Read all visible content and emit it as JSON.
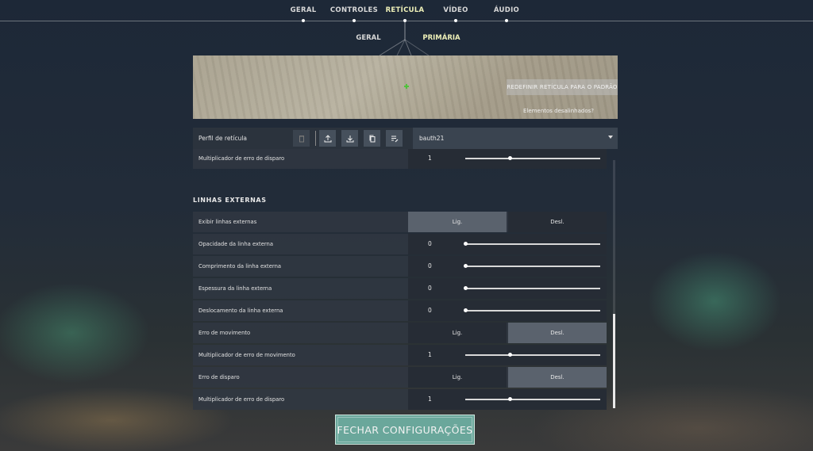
{
  "nav": {
    "tabs": [
      {
        "label": "GERAL",
        "active": false
      },
      {
        "label": "CONTROLES",
        "active": false
      },
      {
        "label": "RETÍCULA",
        "active": true
      },
      {
        "label": "VÍDEO",
        "active": false
      },
      {
        "label": "ÁUDIO",
        "active": false
      }
    ],
    "subtabs": [
      {
        "label": "GERAL",
        "active": false
      },
      {
        "label": "PRIMÁRIA",
        "active": true
      }
    ]
  },
  "preview": {
    "reset_label": "REDEFINIR RETÍCULA PARA O PADRÃO",
    "misaligned_label": "Elementos desalinhados?",
    "crosshair_color": "#4fc33b"
  },
  "profile": {
    "label": "Perfil de retícula",
    "selected": "bauth21",
    "buttons": [
      "trash-icon",
      "upload-icon",
      "download-icon",
      "copy-icon",
      "rename-icon"
    ]
  },
  "settings": {
    "top_row": {
      "label": "Multiplicador de erro de disparo",
      "value": "1",
      "fraction": 0.33
    },
    "section_title": "LINHAS EXTERNAS",
    "rows": [
      {
        "type": "toggle",
        "label": "Exibir linhas externas",
        "on_label": "Lig.",
        "off_label": "Desl.",
        "state": "on"
      },
      {
        "type": "slider",
        "label": "Opacidade da linha externa",
        "value": "0",
        "fraction": 0.0
      },
      {
        "type": "slider",
        "label": "Comprimento da linha externa",
        "value": "0",
        "fraction": 0.0
      },
      {
        "type": "slider",
        "label": "Espessura da linha externa",
        "value": "0",
        "fraction": 0.0
      },
      {
        "type": "slider",
        "label": "Deslocamento da linha externa",
        "value": "0",
        "fraction": 0.0
      },
      {
        "type": "toggle",
        "label": "Erro de movimento",
        "on_label": "Lig.",
        "off_label": "Desl.",
        "state": "off"
      },
      {
        "type": "slider",
        "label": "Multiplicador de erro de movimento",
        "value": "1",
        "fraction": 0.33
      },
      {
        "type": "toggle",
        "label": "Erro de disparo",
        "on_label": "Lig.",
        "off_label": "Desl.",
        "state": "off"
      },
      {
        "type": "slider",
        "label": "Multiplicador de erro de disparo",
        "value": "1",
        "fraction": 0.33
      }
    ]
  },
  "footer": {
    "close_label": "FECHAR CONFIGURAÇÕES",
    "accent": "#6aa79b"
  }
}
